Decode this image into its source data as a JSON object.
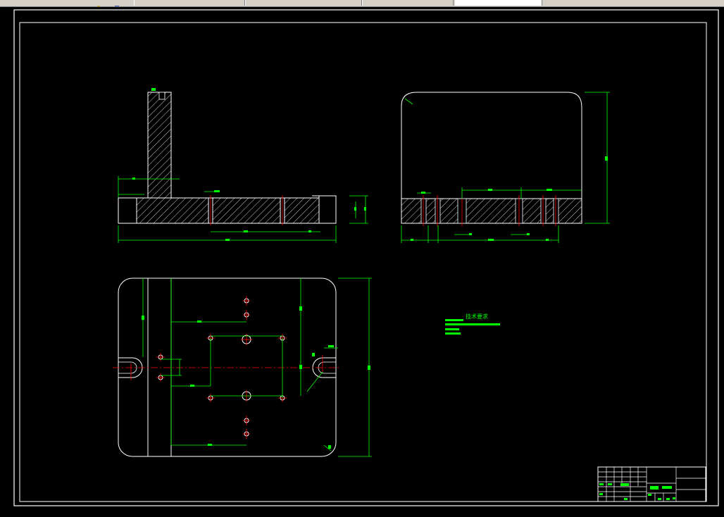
{
  "toolbar": {
    "segments": [
      "",
      "",
      "",
      "",
      ""
    ],
    "active_field": ""
  },
  "drawing": {
    "background_color": "#000000",
    "outline_color": "#ffffff",
    "section_hatch_color": "#ffffff",
    "dimension_color": "#00ff00",
    "center_line_color": "#ff0000",
    "notes": {
      "title": "技术要求",
      "lines": [
        "",
        "",
        "",
        ""
      ]
    },
    "title_block": {
      "drawing_name": "",
      "material": ""
    }
  }
}
